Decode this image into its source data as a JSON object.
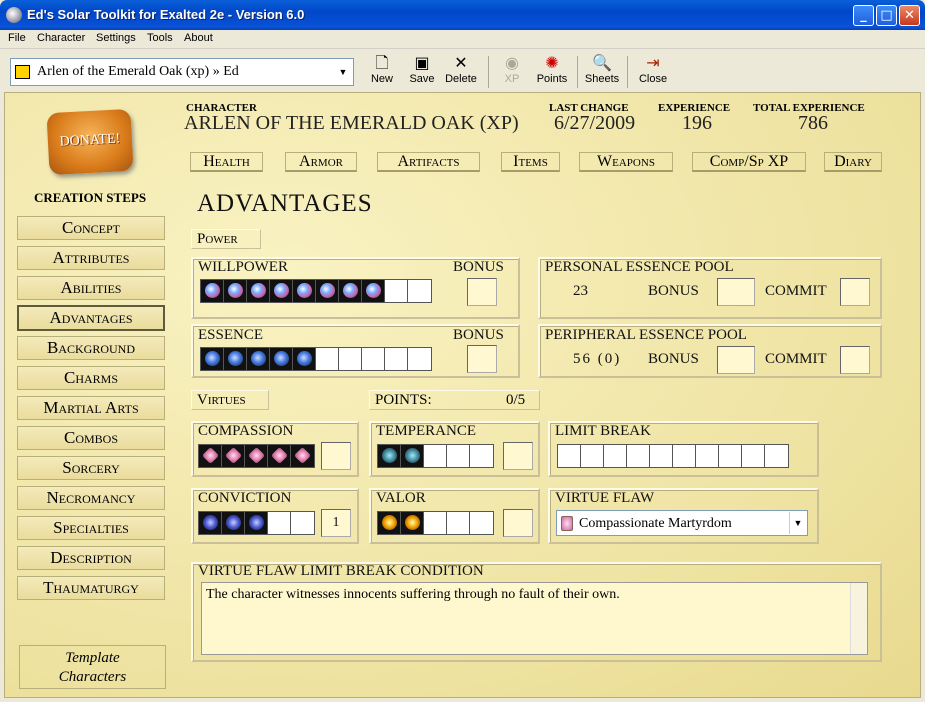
{
  "window": {
    "title": "Ed's Solar Toolkit for Exalted 2e - Version 6.0",
    "minimize": "_",
    "maximize": "□",
    "close": "✕"
  },
  "menu": [
    "File",
    "Character",
    "Settings",
    "Tools",
    "About"
  ],
  "toolbar": {
    "character_select": "Arlen of the Emerald Oak (xp) » Ed",
    "new": "New",
    "save": "Save",
    "delete": "Delete",
    "xp": "XP",
    "points": "Points",
    "sheets": "Sheets",
    "close": "Close"
  },
  "icons": {
    "new": "new-document-icon",
    "save": "floppy-disk-icon",
    "delete": "x-icon",
    "xp": "xp-disc-icon",
    "points": "points-icon",
    "sheets": "sheets-search-icon",
    "close": "exit-door-icon"
  },
  "sidebar": {
    "donate": "DONATE!",
    "heading": "CREATION STEPS",
    "steps": [
      "Concept",
      "Attributes",
      "Abilities",
      "Advantages",
      "Background",
      "Charms",
      "Martial Arts",
      "Combos",
      "Sorcery",
      "Necromancy",
      "Specialties",
      "Description",
      "Thaumaturgy"
    ],
    "active_step": "Advantages",
    "templates_line1": "Template",
    "templates_line2": "Characters"
  },
  "header": {
    "character_label": "CHARACTER",
    "character_name": "ARLEN OF THE EMERALD OAK (XP)",
    "last_change_label": "LAST CHANGE",
    "last_change": "6/27/2009",
    "experience_label": "EXPERIENCE",
    "experience": "196",
    "total_experience_label": "TOTAL EXPERIENCE",
    "total_experience": "786"
  },
  "tabs": [
    "Health",
    "Armor",
    "Artifacts",
    "Items",
    "Weapons",
    "Comp/Sp XP",
    "Diary"
  ],
  "page_title": "ADVANTAGES",
  "power": {
    "label": "Power",
    "willpower": {
      "label": "WILLPOWER",
      "bonus_label": "BONUS",
      "value": 8,
      "max": 10,
      "bonus": ""
    },
    "essence": {
      "label": "ESSENCE",
      "bonus_label": "BONUS",
      "value": 5,
      "max": 10,
      "bonus": ""
    },
    "personal": {
      "label": "PERSONAL ESSENCE POOL",
      "value": "23",
      "bonus_label": "BONUS",
      "commit_label": "COMMIT"
    },
    "peripheral": {
      "label": "PERIPHERAL ESSENCE POOL",
      "value": "56 (0)",
      "bonus_label": "BONUS",
      "commit_label": "COMMIT"
    }
  },
  "virtues": {
    "label": "Virtues",
    "points_label": "POINTS:",
    "points": "0/5",
    "compassion": {
      "label": "COMPASSION",
      "value": 5,
      "max": 5,
      "bonus": ""
    },
    "temperance": {
      "label": "TEMPERANCE",
      "value": 2,
      "max": 5,
      "bonus": ""
    },
    "conviction": {
      "label": "CONVICTION",
      "value": 3,
      "max": 5,
      "bonus": "1"
    },
    "valor": {
      "label": "VALOR",
      "value": 2,
      "max": 5,
      "bonus": ""
    },
    "limit_break": {
      "label": "LIMIT BREAK",
      "value": 0,
      "max": 10
    },
    "virtue_flaw": {
      "label": "VIRTUE FLAW",
      "selected": "Compassionate Martyrdom"
    }
  },
  "flaw_condition": {
    "label": "VIRTUE FLAW LIMIT BREAK CONDITION",
    "text": "The character witnesses innocents suffering through no fault of their own."
  },
  "colors": {
    "titlebar": "#0a52d6",
    "panel_bg": "#f4ebb8",
    "frame": "#ece9d8"
  }
}
